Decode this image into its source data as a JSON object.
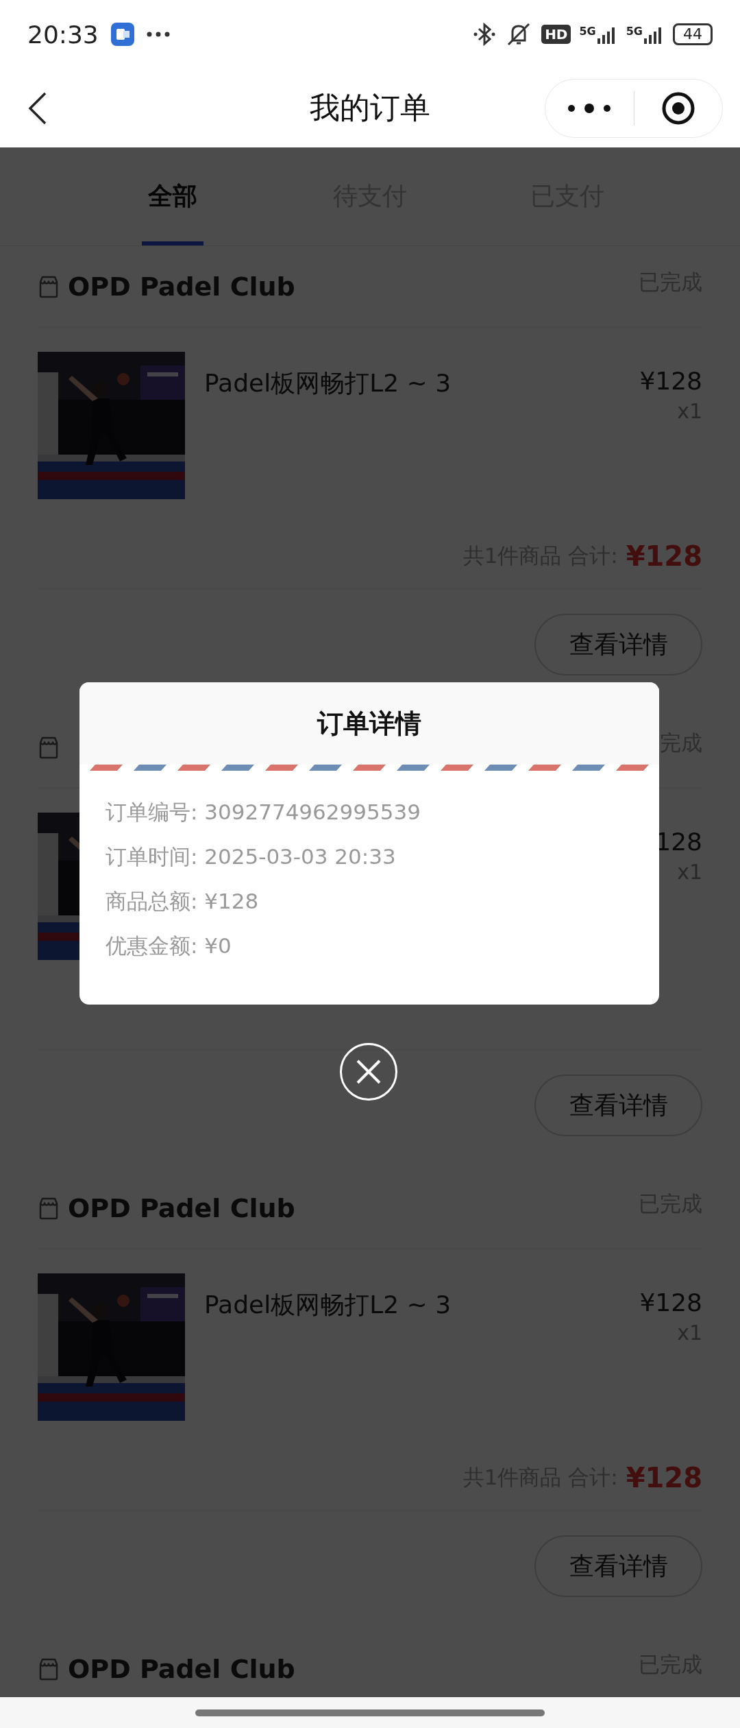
{
  "status_bar": {
    "time": "20:33",
    "hd_badge": "HD",
    "network_labels": [
      "5G",
      "5G"
    ],
    "battery": "44"
  },
  "nav": {
    "title": "我的订单"
  },
  "tabs": [
    {
      "label": "全部",
      "selected": true
    },
    {
      "label": "待支付",
      "selected": false
    },
    {
      "label": "已支付",
      "selected": false
    }
  ],
  "orders": [
    {
      "store_name": "OPD Padel Club",
      "status": "已完成",
      "item": {
        "kind": "picture",
        "name": "Padel板网畅打L2 ~ 3",
        "price": "¥128",
        "quantity": "x1"
      },
      "summary": {
        "label": "共1件商品 合计:",
        "total": "¥128"
      },
      "button": "查看详情"
    },
    {
      "status": "完成",
      "item": {
        "kind": "picture",
        "price": "128",
        "quantity": "x1"
      },
      "button": "查看详情"
    },
    {
      "store_name": "OPD Padel Club",
      "status": "已完成",
      "item": {
        "kind": "picture",
        "name": "Padel板网畅打L2 ~ 3",
        "price": "¥128",
        "quantity": "x1"
      },
      "summary": {
        "label": "共1件商品 合计:",
        "total": "¥128"
      },
      "button": "查看详情"
    },
    {
      "store_name": "OPD Padel Club",
      "status": "已完成"
    }
  ],
  "dialog": {
    "title": "订单详情",
    "lines": [
      "订单编号: 3092774962995539",
      "订单时间: 2025-03-03 20:33",
      "商品总额: ¥128",
      "优惠金额: ¥0"
    ]
  }
}
